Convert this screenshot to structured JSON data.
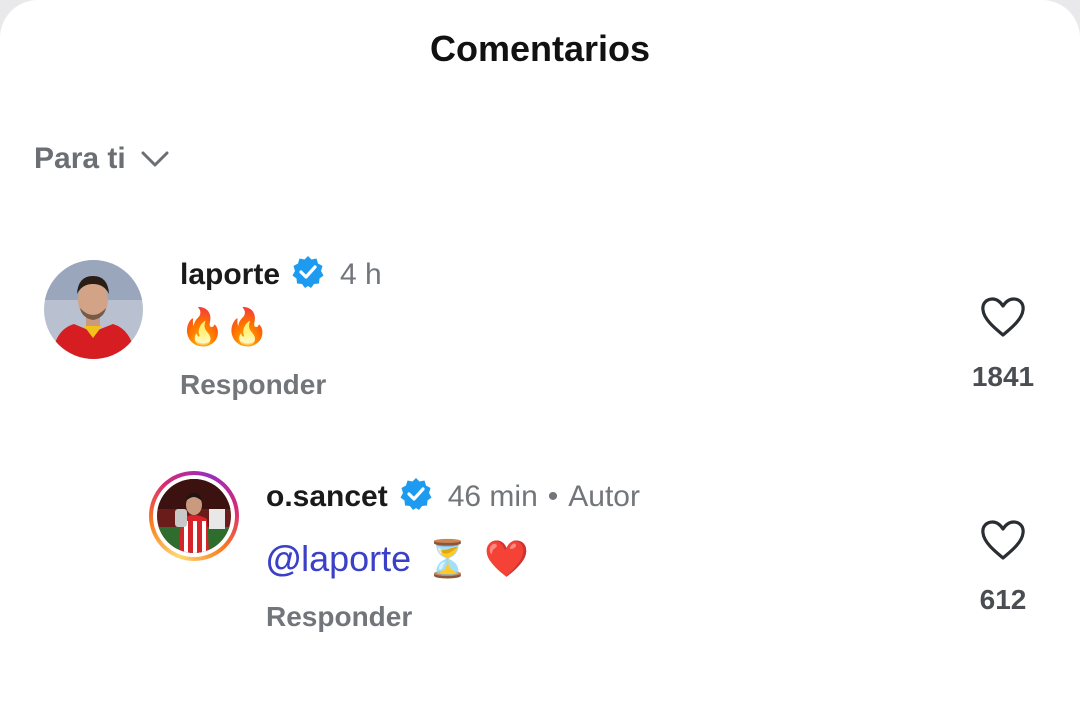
{
  "header": {
    "title": "Comentarios"
  },
  "sort": {
    "label": "Para ti"
  },
  "comments": [
    {
      "username": "laporte",
      "verified": true,
      "time": "4 h",
      "text": "🔥🔥",
      "reply_label": "Responder",
      "likes": "1841"
    },
    {
      "username": "o.sancet",
      "verified": true,
      "time": "46 min",
      "author_badge": "Autor",
      "mention": "laporte",
      "mention_prefix": "@",
      "emojis": [
        "⏳",
        "❤️"
      ],
      "reply_label": "Responder",
      "likes": "612"
    }
  ],
  "colors": {
    "verified": "#1d9bf0",
    "mention": "#3a41c8",
    "muted_text": "#72767b"
  },
  "icons": [
    "chevron-down-icon",
    "verified-badge-icon",
    "heart-outline-icon",
    "threads-at-icon"
  ]
}
